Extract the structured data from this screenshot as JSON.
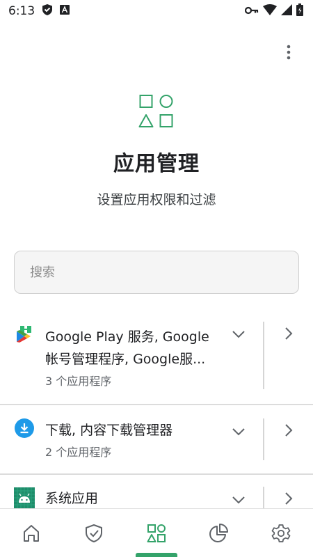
{
  "status_bar": {
    "time": "6:13"
  },
  "header": {
    "title": "应用管理",
    "subtitle": "设置应用权限和过滤"
  },
  "search": {
    "placeholder": "搜索",
    "value": ""
  },
  "app_groups": [
    {
      "icon": "google-play-services-icon",
      "title_line1": "Google Play 服务, Google",
      "title_line2": "帐号管理程序, Google服...",
      "count_label": "3 个应用程序"
    },
    {
      "icon": "download-manager-icon",
      "title_line1": "下载, 内容下载管理器",
      "count_label": "2 个应用程序"
    },
    {
      "icon": "android-system-icon",
      "title_line1": "系统应用",
      "count_label": ""
    }
  ],
  "bottom_nav": {
    "items": [
      "home",
      "protection",
      "apps",
      "statistics",
      "settings"
    ],
    "active": "apps"
  },
  "colors": {
    "accent": "#34a36a",
    "download_blue": "#1e9ae8"
  }
}
